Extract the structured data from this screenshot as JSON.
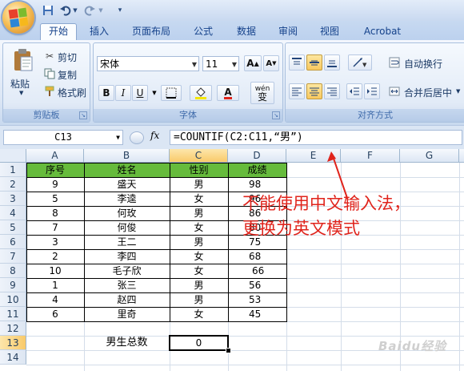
{
  "quick_access": {
    "office_button": "office-logo",
    "save_icon": "save-icon",
    "undo_icon": "undo-icon",
    "redo_icon": "redo-icon",
    "customize_icon": "customize-arrow-icon"
  },
  "ribbon_tabs": [
    "开始",
    "插入",
    "页面布局",
    "公式",
    "数据",
    "审阅",
    "视图",
    "Acrobat"
  ],
  "active_tab": "开始",
  "clipboard": {
    "paste_label": "粘贴",
    "cut_label": "剪切",
    "copy_label": "复制",
    "format_painter_label": "格式刷",
    "group_label": "剪贴板"
  },
  "font": {
    "font_name": "宋体",
    "font_size": "11",
    "grow_label": "A",
    "shrink_label": "A",
    "bold": "B",
    "italic": "I",
    "underline": "U",
    "font_color_label": "A",
    "wen_label": "wén",
    "bian_label": "变",
    "group_label": "字体"
  },
  "alignment": {
    "wrap_text_label": "自动换行",
    "merge_center_label": "合并后居中",
    "group_label": "对齐方式"
  },
  "formula_bar": {
    "name_box": "C13",
    "fx_label": "fx",
    "formula": "=COUNTIF(C2:C11,“男”)"
  },
  "columns": [
    "A",
    "B",
    "C",
    "D",
    "E",
    "F",
    "G"
  ],
  "selected_column": "C",
  "rows": [
    "1",
    "2",
    "3",
    "4",
    "5",
    "6",
    "7",
    "8",
    "9",
    "10",
    "11",
    "12",
    "13",
    "14"
  ],
  "selected_row": "13",
  "table": {
    "headers": [
      "序号",
      "姓名",
      "性别",
      "成绩"
    ],
    "rows": [
      [
        "9",
        "盛天",
        "男",
        "98"
      ],
      [
        "5",
        "李逵",
        "女",
        "96"
      ],
      [
        "8",
        "何玫",
        "男",
        "86"
      ],
      [
        "7",
        "何俊",
        "女",
        "80"
      ],
      [
        "3",
        "王二",
        "男",
        "75"
      ],
      [
        "2",
        "李四",
        "女",
        "68"
      ],
      [
        "10",
        "毛子欣",
        "女",
        "66"
      ],
      [
        "1",
        "张三",
        "男",
        "56"
      ],
      [
        "4",
        "赵四",
        "男",
        "53"
      ],
      [
        "6",
        "里奇",
        "女",
        "45"
      ]
    ]
  },
  "summary": {
    "label": "男生总数",
    "value": "0"
  },
  "annotation": {
    "line1": "不能使用中文输入法，",
    "line2": "更换为英文模式",
    "color": "#e0241c"
  },
  "watermark": "Baidu经验",
  "colors": {
    "header_green": "#66bb3c",
    "ribbon_blue": "#c7d9f1",
    "selected_header": "#f9ca6a"
  }
}
